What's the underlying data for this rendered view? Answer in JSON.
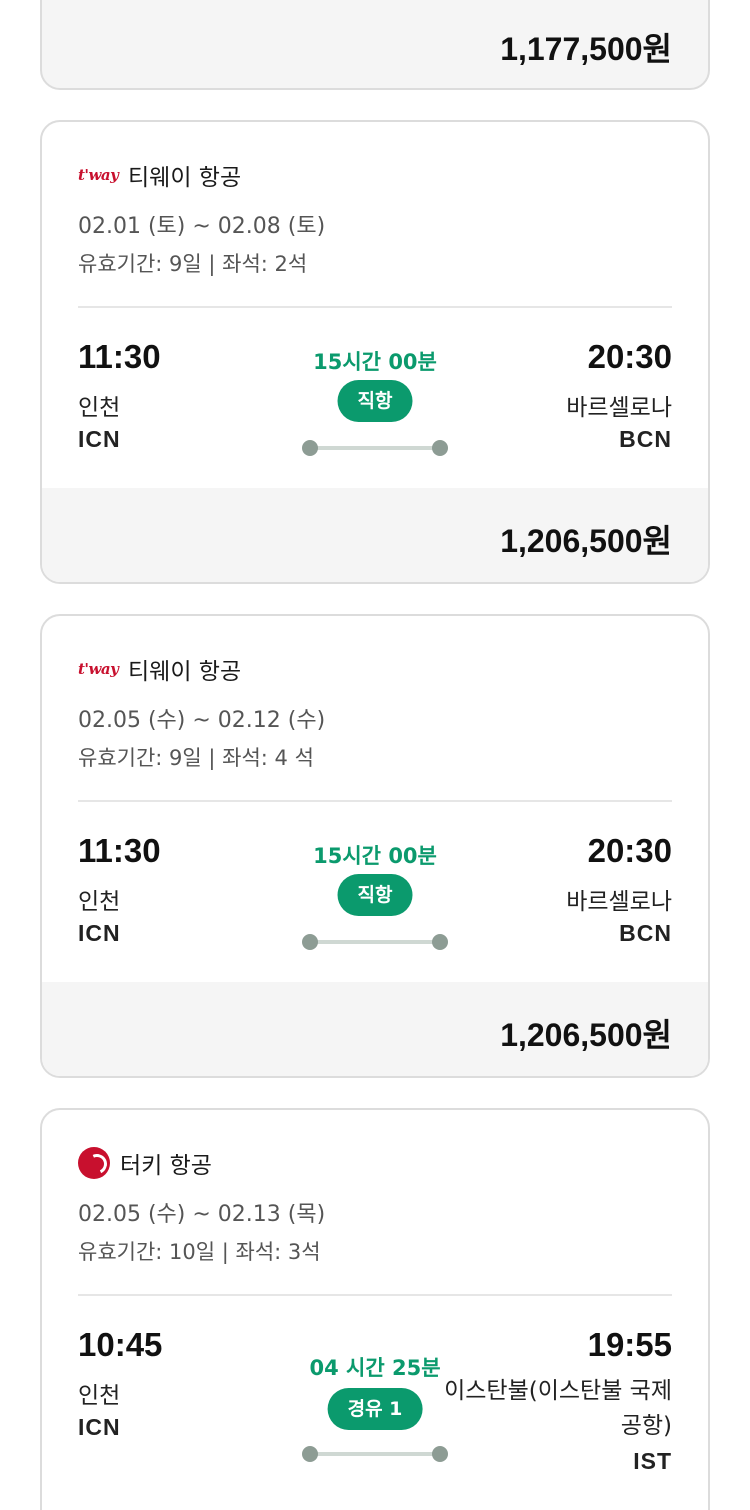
{
  "colors": {
    "accent": "#0b9a6d",
    "border": "#dcdcdc",
    "band": "#f5f5f5",
    "brand_red": "#c8102e"
  },
  "top_card": {
    "price": "1,177,500원"
  },
  "flights": [
    {
      "airline_logo": "tway-logo",
      "logo_text": "t'way",
      "airline": "티웨이 항공",
      "dates": "02.01 (토) ~ 02.08 (토)",
      "meta": "유효기간: 9일 | 좌석: 2석",
      "dep_time": "11:30",
      "dep_city": "인천",
      "dep_code": "ICN",
      "duration": "15시간 00분",
      "badge": "직항",
      "arr_time": "20:30",
      "arr_city": "바르셀로나",
      "arr_code": "BCN",
      "price": "1,206,500원"
    },
    {
      "airline_logo": "tway-logo",
      "logo_text": "t'way",
      "airline": "티웨이 항공",
      "dates": "02.05 (수) ~ 02.12 (수)",
      "meta": "유효기간: 9일 | 좌석: 4 석",
      "dep_time": "11:30",
      "dep_city": "인천",
      "dep_code": "ICN",
      "duration": "15시간 00분",
      "badge": "직항",
      "arr_time": "20:30",
      "arr_city": "바르셀로나",
      "arr_code": "BCN",
      "price": "1,206,500원"
    },
    {
      "airline_logo": "turkish-airlines-logo",
      "airline": "터키 항공",
      "dates": "02.05 (수) ~ 02.13 (목)",
      "meta": "유효기간: 10일 | 좌석: 3석",
      "dep_time": "10:45",
      "dep_city": "인천",
      "dep_code": "ICN",
      "duration": "04 시간 25분",
      "badge": "경유 1",
      "arr_time": "19:55",
      "arr_city": "이스탄불(이스탄불 국제공항)",
      "arr_code": "IST"
    }
  ]
}
